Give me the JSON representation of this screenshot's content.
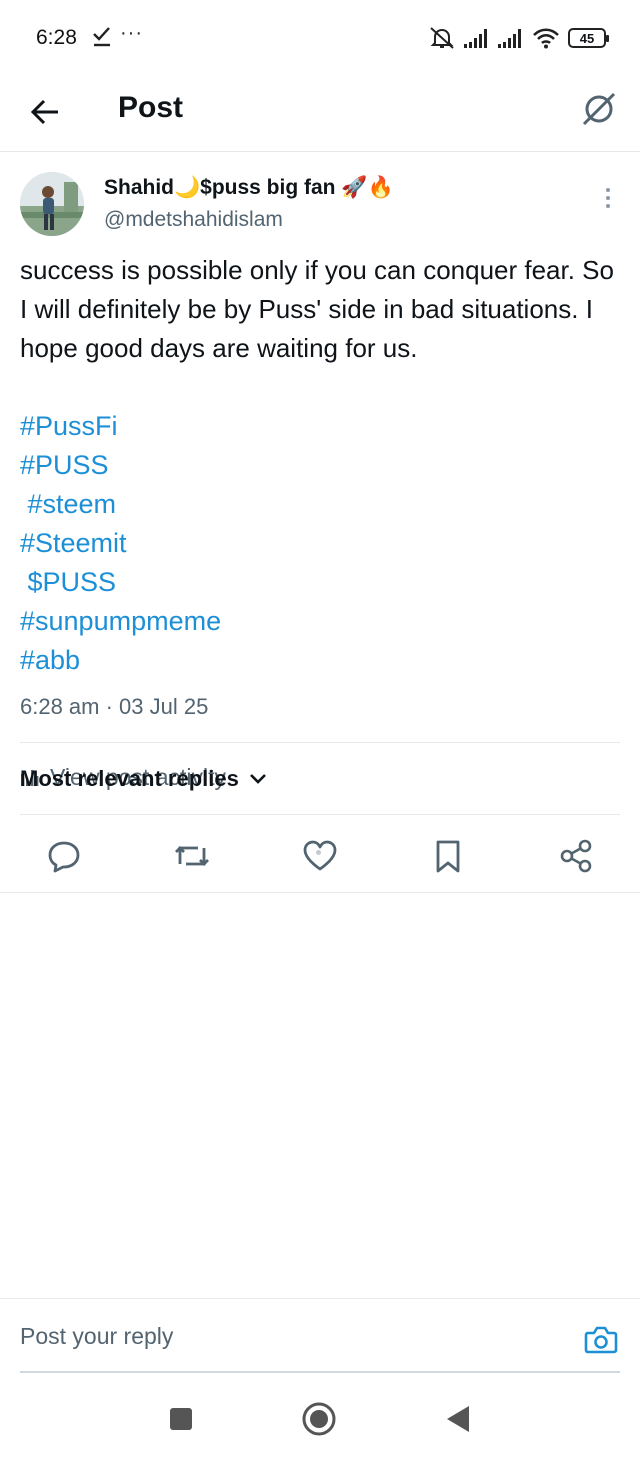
{
  "status_bar": {
    "time": "6:28",
    "more": "···",
    "battery": "45"
  },
  "header": {
    "title": "Post"
  },
  "post": {
    "display_name": "Shahid🌙$puss big fan 🚀🔥",
    "handle": "@mdetshahidislam",
    "text": "success is possible only if you can conquer fear. So I will definitely be by Puss' side in bad situations. I hope good days are waiting for us.",
    "hashtags": [
      "#PussFi",
      "#PUSS",
      " #steem",
      "#Steemit",
      " $PUSS",
      "#sunpumpmeme",
      "#abb"
    ],
    "timestamp": "6:28 am · 03 Jul 25",
    "view_activity": "View post activity"
  },
  "replies": {
    "filter_label": "Most relevant replies"
  },
  "reply_bar": {
    "placeholder": "Post your reply"
  },
  "colors": {
    "accent": "#1d8fd6",
    "text_primary": "#0f1419",
    "text_secondary": "#536471",
    "divider": "#e6e9ec"
  }
}
